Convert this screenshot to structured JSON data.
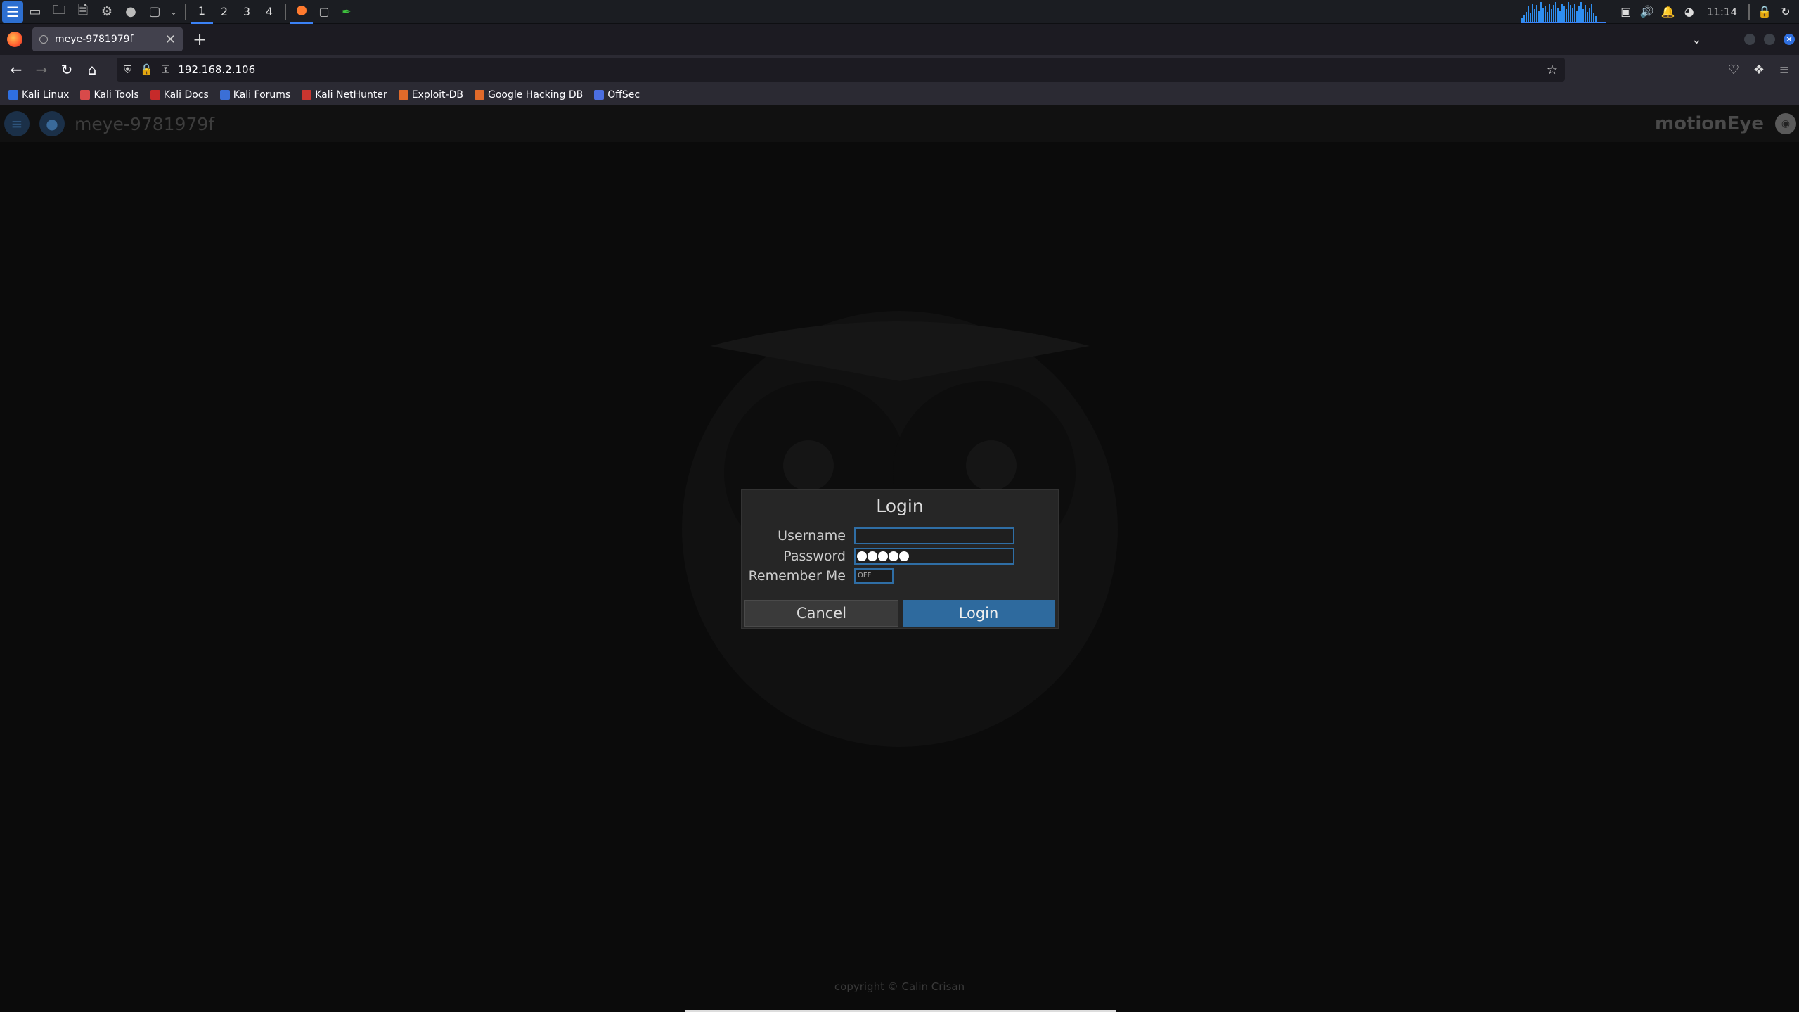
{
  "taskbar": {
    "workspaces": [
      "1",
      "2",
      "3",
      "4"
    ],
    "active_workspace": "1",
    "clock": "11:14",
    "accent_color": "#3b82f6"
  },
  "browser": {
    "tab_title": "meye-9781979f",
    "url": "192.168.2.106",
    "bookmarks": [
      "Kali Linux",
      "Kali Tools",
      "Kali Docs",
      "Kali Forums",
      "Kali NetHunter",
      "Exploit-DB",
      "Google Hacking DB",
      "OffSec"
    ]
  },
  "app": {
    "hostname": "meye-9781979f",
    "brand": "motionEye",
    "footer": "copyright © Calin Crisan"
  },
  "login": {
    "title": "Login",
    "username_label": "Username",
    "username_value": "",
    "password_label": "Password",
    "password_length": 5,
    "remember_label": "Remember Me",
    "remember_state": "OFF",
    "cancel_label": "Cancel",
    "login_label": "Login",
    "accent_color": "#2e6a9e"
  }
}
